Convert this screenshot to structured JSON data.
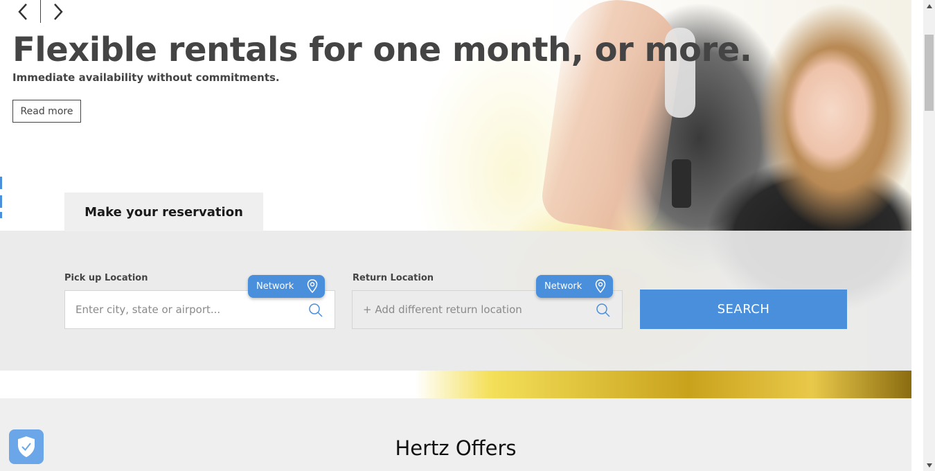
{
  "hero": {
    "headline": "Flexible rentals for one month, or more.",
    "subline": "Immediate availability without commitments.",
    "read_more": "Read more"
  },
  "slider": {
    "prev_icon": "chevron-left-icon",
    "next_icon": "chevron-right-icon"
  },
  "reservation": {
    "tab_label": "Make your reservation",
    "pickup": {
      "label": "Pick up Location",
      "placeholder": "Enter city, state or airport...",
      "network_label": "Network"
    },
    "return": {
      "label": "Return Location",
      "placeholder": "+ Add different return location",
      "network_label": "Network"
    },
    "search_label": "SEARCH"
  },
  "offers": {
    "title": "Hertz Offers"
  },
  "colors": {
    "accent": "#4a8fdc",
    "text": "#444444",
    "panel": "#e9e9e9"
  }
}
